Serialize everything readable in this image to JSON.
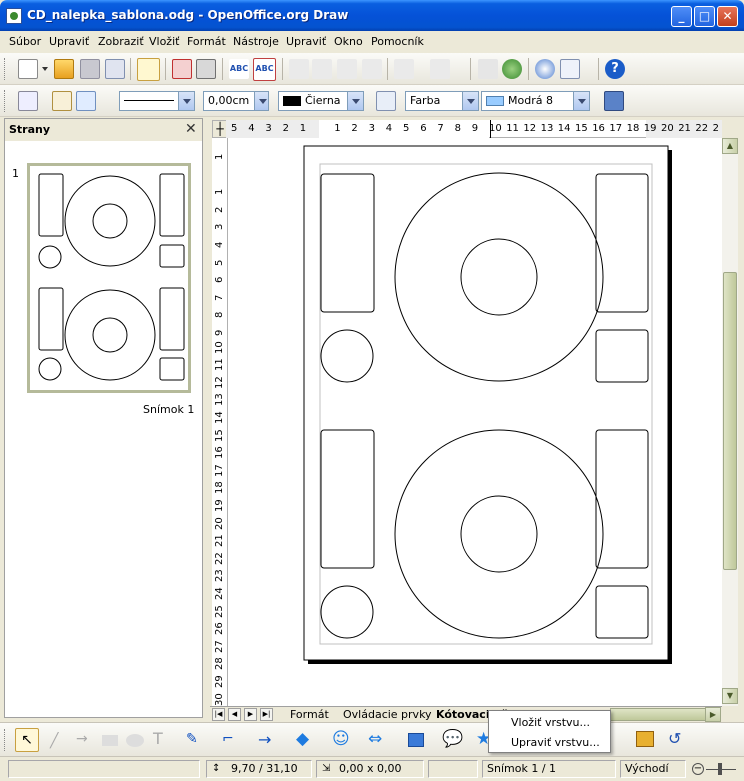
{
  "window": {
    "title": "CD_nalepka_sablona.odg - OpenOffice.org Draw",
    "minimize": "_",
    "maximize": "□",
    "close": "✕"
  },
  "menu": [
    "Súbor",
    "Upraviť",
    "Zobraziť",
    "Vložiť",
    "Formát",
    "Nástroje",
    "Upraviť",
    "Okno",
    "Pomocník"
  ],
  "line_toolbar": {
    "line_style": "",
    "line_width": "0,00cm",
    "line_color": "Čierna",
    "line_color_swatch": "#000000",
    "area_style": "Farba",
    "area_color": "Modrá 8",
    "area_color_swatch": "#99ccff"
  },
  "panel": {
    "title": "Strany",
    "close": "✕",
    "slide_number": "1",
    "slide_caption": "Snímok 1"
  },
  "rulers": {
    "horizontal": [
      "5",
      "4",
      "3",
      "2",
      "1",
      "",
      "1",
      "2",
      "3",
      "4",
      "5",
      "6",
      "7",
      "8",
      "9",
      "10",
      "11",
      "12",
      "13",
      "14",
      "15",
      "16",
      "17",
      "18",
      "19",
      "20",
      "21",
      "22",
      "2"
    ],
    "vertical": [
      "1",
      "",
      "1",
      "2",
      "3",
      "4",
      "5",
      "6",
      "7",
      "8",
      "9",
      "10",
      "11",
      "12",
      "13",
      "14",
      "15",
      "16",
      "17",
      "18",
      "19",
      "20",
      "21",
      "22",
      "23",
      "24",
      "25",
      "26",
      "27",
      "28",
      "29",
      "30"
    ]
  },
  "tabs": [
    "Formát",
    "Ovládacie prvky",
    "Kótovacie č"
  ],
  "context_menu": [
    "Vložiť vrstvu...",
    "Upraviť vrstvu..."
  ],
  "status": {
    "position": "9,70 / 31,10",
    "size": "0,00 x 0,00",
    "slide": "Snímok 1 / 1",
    "layout": "Východí"
  },
  "colors": {
    "titlebar": "#0552d8",
    "chrome": "#ece9d8",
    "accent": "#316ac5"
  }
}
